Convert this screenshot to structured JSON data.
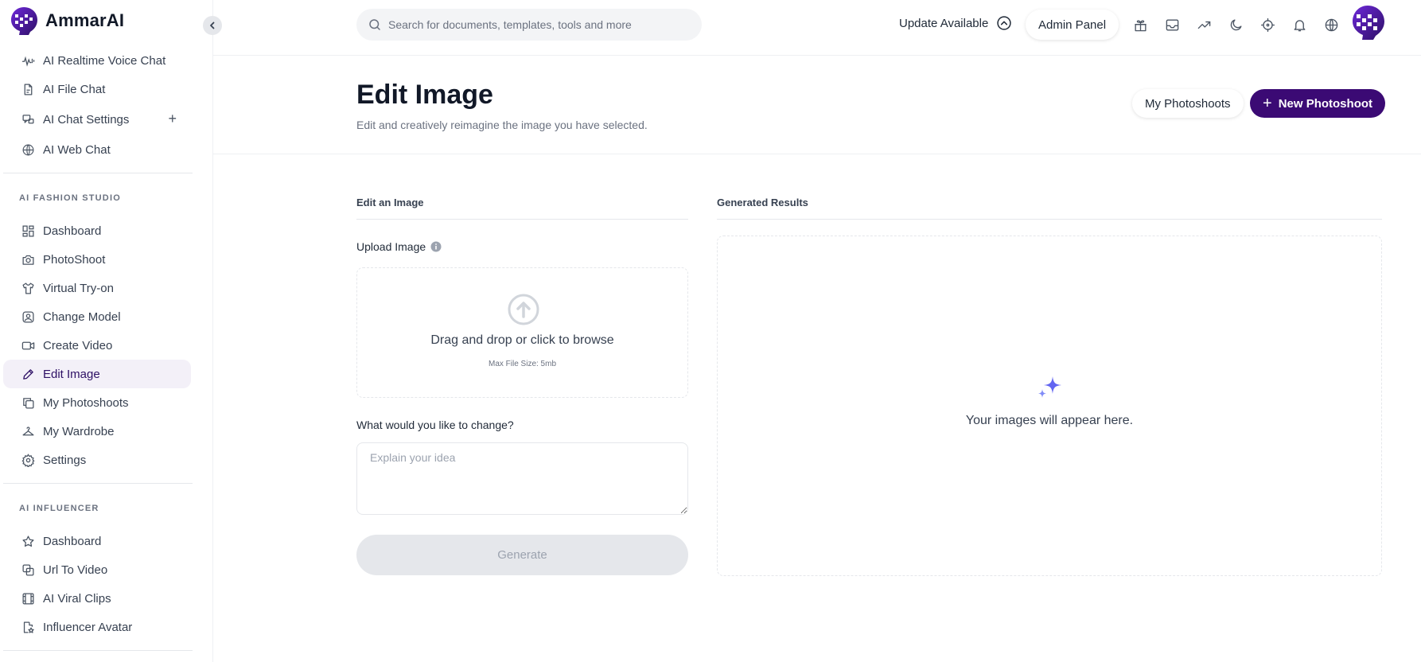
{
  "brand": {
    "name": "AmmarAI"
  },
  "sidebar": {
    "top_items": [
      {
        "label": "AI Realtime Voice Chat",
        "icon": "voice-wave-icon"
      },
      {
        "label": "AI File Chat",
        "icon": "file-icon"
      },
      {
        "label": "AI Chat Settings",
        "icon": "chat-settings-icon",
        "action": "+"
      },
      {
        "label": "AI Web Chat",
        "icon": "www-globe-icon"
      }
    ],
    "fashion_section": "AI FASHION STUDIO",
    "fashion_items": [
      {
        "label": "Dashboard",
        "icon": "dashboard-icon"
      },
      {
        "label": "PhotoShoot",
        "icon": "camera-icon"
      },
      {
        "label": "Virtual Try-on",
        "icon": "shirt-icon"
      },
      {
        "label": "Change Model",
        "icon": "user-square-icon"
      },
      {
        "label": "Create Video",
        "icon": "video-icon"
      },
      {
        "label": "Edit Image",
        "icon": "pencil-icon",
        "active": true
      },
      {
        "label": "My Photoshoots",
        "icon": "copy-icon"
      },
      {
        "label": "My Wardrobe",
        "icon": "hanger-icon"
      },
      {
        "label": "Settings",
        "icon": "gear-icon"
      }
    ],
    "influencer_section": "AI INFLUENCER",
    "influencer_items": [
      {
        "label": "Dashboard",
        "icon": "star-icon"
      },
      {
        "label": "Url To Video",
        "icon": "link-video-icon"
      },
      {
        "label": "AI Viral Clips",
        "icon": "film-icon"
      },
      {
        "label": "Influencer Avatar",
        "icon": "avatar-file-icon"
      }
    ]
  },
  "header": {
    "search_placeholder": "Search for documents, templates, tools and more",
    "update_label": "Update Available",
    "admin_label": "Admin Panel",
    "icons": [
      "gift-icon",
      "inbox-icon",
      "trending-icon",
      "moon-icon",
      "crosshair-icon",
      "bell-icon",
      "globe-icon"
    ]
  },
  "page": {
    "title": "Edit Image",
    "subtitle": "Edit and creatively reimagine the image you have selected.",
    "my_photoshoots": "My Photoshoots",
    "new_photoshoot": "New Photoshoot"
  },
  "editor": {
    "section_title": "Edit an Image",
    "upload_label": "Upload Image",
    "dropzone_text": "Drag and drop or click to browse",
    "max_size": "Max File Size: 5mb",
    "question": "What would you like to change?",
    "idea_placeholder": "Explain your idea",
    "generate": "Generate"
  },
  "results": {
    "section_title": "Generated Results",
    "empty_text": "Your images will appear here."
  },
  "colors": {
    "primary": "#3b0a74",
    "active_bg": "#f3f0f8",
    "sparkle": "#6366f1"
  }
}
